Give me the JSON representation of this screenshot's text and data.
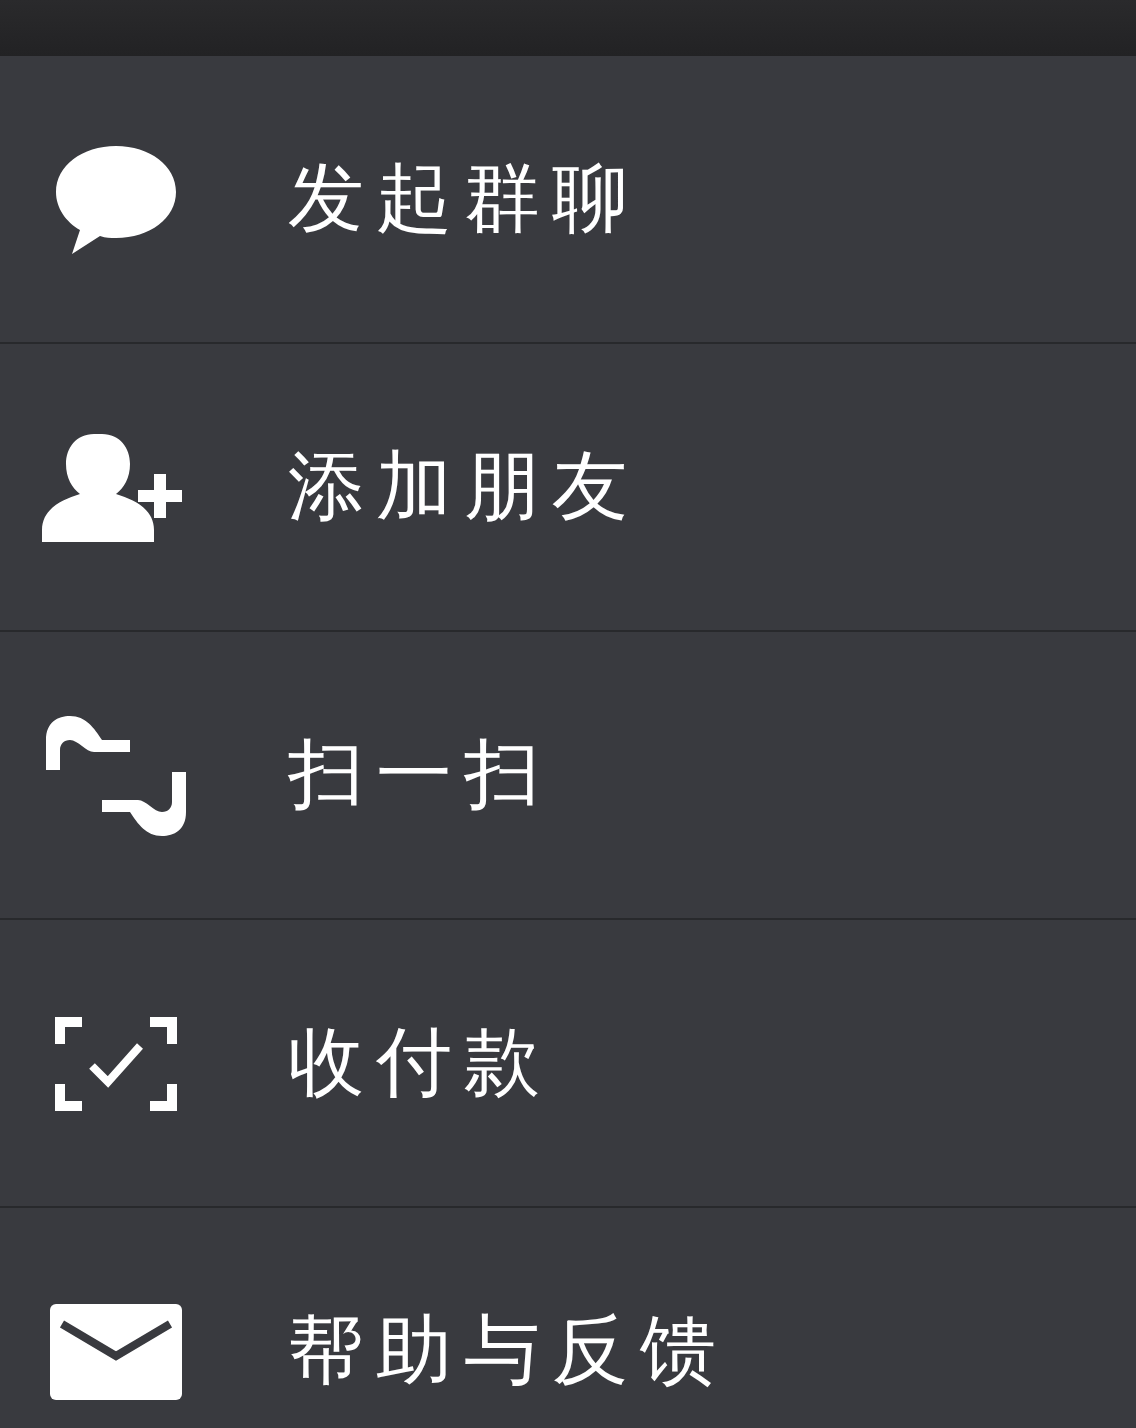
{
  "menu": [
    {
      "kind": "chat",
      "label": "发起群聊"
    },
    {
      "kind": "add-user",
      "label": "添加朋友"
    },
    {
      "kind": "scan",
      "label": "扫一扫"
    },
    {
      "kind": "pay",
      "label": "收付款"
    },
    {
      "kind": "mail",
      "label": "帮助与反馈"
    }
  ]
}
